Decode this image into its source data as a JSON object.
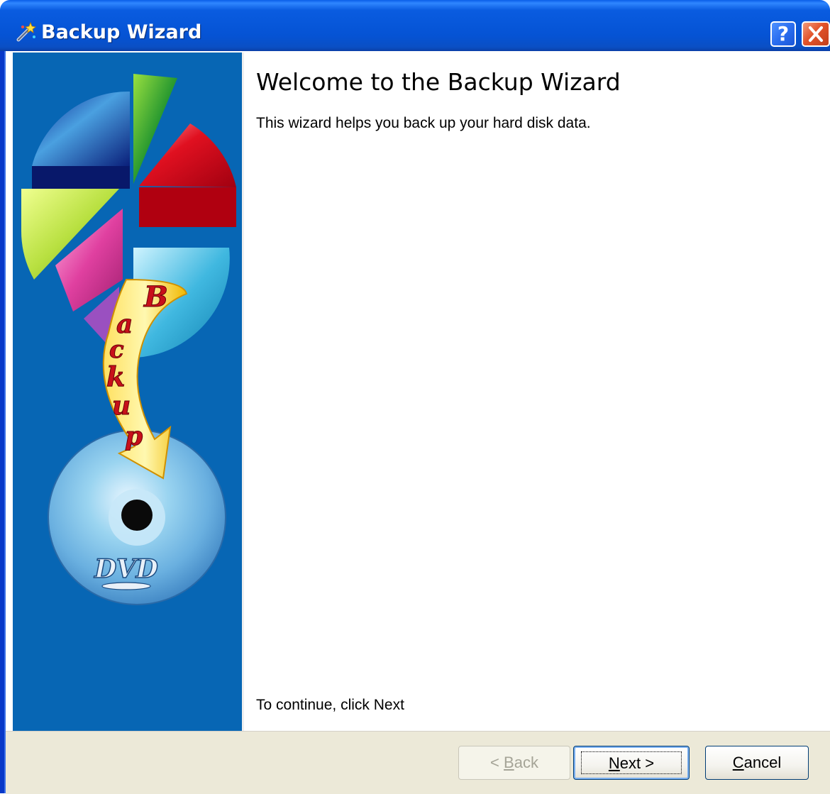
{
  "window": {
    "title": "Backup Wizard",
    "help_label": "?",
    "close_label": "✕",
    "app_icon": "wizard-wand-icon"
  },
  "banner": {
    "art_text": "Backup",
    "disc_label": "DVD"
  },
  "content": {
    "heading": "Welcome to the Backup Wizard",
    "description": "This wizard helps you back up your hard disk data.",
    "continue_hint": "To continue, click Next"
  },
  "buttons": {
    "back": {
      "prefix": "< ",
      "mnemonic": "B",
      "rest": "ack",
      "enabled": false
    },
    "next": {
      "mnemonic": "N",
      "rest": "ext",
      "suffix": " >",
      "default": true
    },
    "cancel": {
      "mnemonic": "C",
      "rest": "ancel"
    }
  },
  "colors": {
    "titlebar": "#0553d4",
    "banner": "#0766b4",
    "panel": "#ece9d8"
  }
}
